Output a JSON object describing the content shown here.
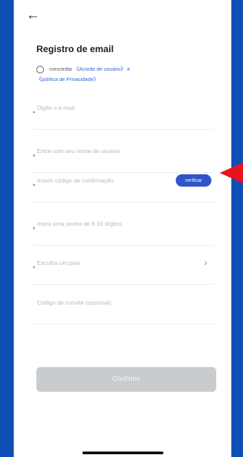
{
  "header": {
    "back_icon": "arrow-left-icon",
    "title": "Registro de email"
  },
  "agreement": {
    "prefix": "concordar",
    "user_agreement_link": "《Acordo de usuário》 e",
    "privacy_link": "《política de Privacidade》"
  },
  "form": {
    "email_placeholder": "Digite o e-mail",
    "username_placeholder": "Entre com seu nome de usuário",
    "code_placeholder": "Inserir código de confirmação",
    "verify_label": "verificar",
    "password_placeholder": "Insira uma senha de 6-16 dígitos",
    "country_placeholder": "Escolha um país",
    "invite_placeholder": "Código de convite (opcional)"
  },
  "confirm_label": "Confirme",
  "colors": {
    "accent": "#2f55c9",
    "background": "#0f4fb5",
    "annotation_arrow": "#e8141b"
  }
}
